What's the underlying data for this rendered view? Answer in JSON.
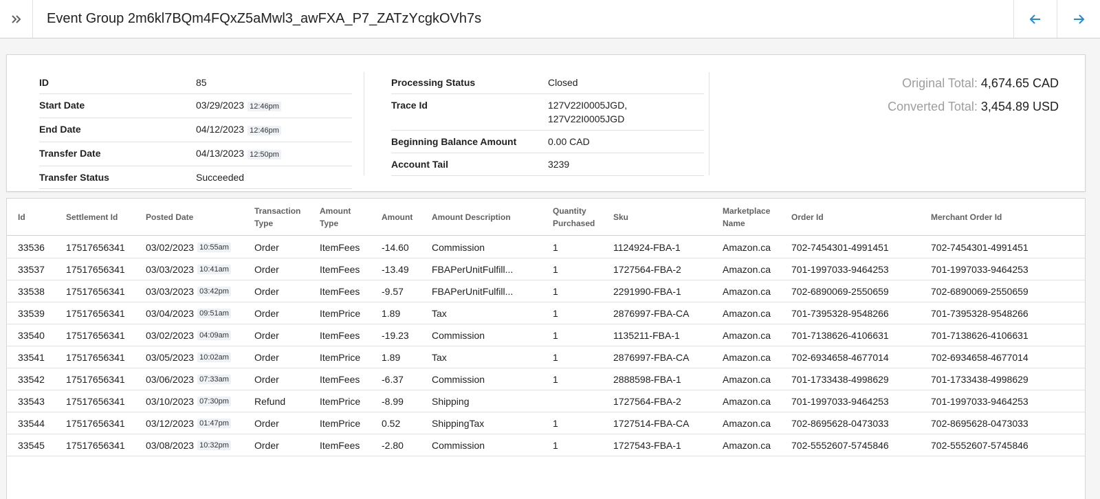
{
  "header": {
    "title": "Event Group 2m6kl7BQm4FQxZ5aMwl3_awFXA_P7_ZATzYcgkOVh7s",
    "toggle_icon": "double-chevron-right-icon",
    "prev_icon": "arrow-left-icon",
    "next_icon": "arrow-right-icon",
    "accent_color": "#1e88e5"
  },
  "summary": {
    "left": [
      {
        "key": "ID",
        "value": "85",
        "time": ""
      },
      {
        "key": "Start Date",
        "value": "03/29/2023",
        "time": "12:46pm"
      },
      {
        "key": "End Date",
        "value": "04/12/2023",
        "time": "12:46pm"
      },
      {
        "key": "Transfer Date",
        "value": "04/13/2023",
        "time": "12:50pm"
      },
      {
        "key": "Transfer Status",
        "value": "Succeeded",
        "time": ""
      }
    ],
    "middle": [
      {
        "key": "Processing Status",
        "value": "Closed"
      },
      {
        "key": "Trace Id",
        "value": "127V22I0005JGD,",
        "value2": "127V22I0005JGD"
      },
      {
        "key": "Beginning Balance Amount",
        "value": "0.00 CAD"
      },
      {
        "key": "Account Tail",
        "value": "3239"
      }
    ],
    "totals": {
      "original_label": "Original Total:",
      "original_value": "4,674.65 CAD",
      "converted_label": "Converted Total:",
      "converted_value": "3,454.89 USD"
    }
  },
  "table": {
    "columns": [
      {
        "line1": "Id",
        "line2": ""
      },
      {
        "line1": "Settlement Id",
        "line2": ""
      },
      {
        "line1": "Posted Date",
        "line2": ""
      },
      {
        "line1": "Transaction",
        "line2": "Type"
      },
      {
        "line1": "Amount",
        "line2": "Type"
      },
      {
        "line1": "Amount",
        "line2": ""
      },
      {
        "line1": "Amount Description",
        "line2": ""
      },
      {
        "line1": "Quantity",
        "line2": "Purchased"
      },
      {
        "line1": "Sku",
        "line2": ""
      },
      {
        "line1": "Marketplace",
        "line2": "Name"
      },
      {
        "line1": "Order Id",
        "line2": ""
      },
      {
        "line1": "Merchant Order Id",
        "line2": ""
      }
    ],
    "rows": [
      {
        "id": "33536",
        "settlement_id": "17517656341",
        "date": "03/02/2023",
        "time": "10:55am",
        "transaction_type": "Order",
        "amount_type": "ItemFees",
        "amount": "-14.60",
        "description": "Commission",
        "quantity": "1",
        "sku": "1124924-FBA-1",
        "marketplace": "Amazon.ca",
        "order_id": "702-7454301-4991451",
        "merchant_order_id": "702-7454301-4991451"
      },
      {
        "id": "33537",
        "settlement_id": "17517656341",
        "date": "03/03/2023",
        "time": "10:41am",
        "transaction_type": "Order",
        "amount_type": "ItemFees",
        "amount": "-13.49",
        "description": "FBAPerUnitFulfill...",
        "quantity": "1",
        "sku": "1727564-FBA-2",
        "marketplace": "Amazon.ca",
        "order_id": "701-1997033-9464253",
        "merchant_order_id": "701-1997033-9464253"
      },
      {
        "id": "33538",
        "settlement_id": "17517656341",
        "date": "03/03/2023",
        "time": "03:42pm",
        "transaction_type": "Order",
        "amount_type": "ItemFees",
        "amount": "-9.57",
        "description": "FBAPerUnitFulfill...",
        "quantity": "1",
        "sku": "2291990-FBA-1",
        "marketplace": "Amazon.ca",
        "order_id": "702-6890069-2550659",
        "merchant_order_id": "702-6890069-2550659"
      },
      {
        "id": "33539",
        "settlement_id": "17517656341",
        "date": "03/04/2023",
        "time": "09:51am",
        "transaction_type": "Order",
        "amount_type": "ItemPrice",
        "amount": "1.89",
        "description": "Tax",
        "quantity": "1",
        "sku": "2876997-FBA-CA",
        "marketplace": "Amazon.ca",
        "order_id": "701-7395328-9548266",
        "merchant_order_id": "701-7395328-9548266"
      },
      {
        "id": "33540",
        "settlement_id": "17517656341",
        "date": "03/02/2023",
        "time": "04:09am",
        "transaction_type": "Order",
        "amount_type": "ItemFees",
        "amount": "-19.23",
        "description": "Commission",
        "quantity": "1",
        "sku": "1135211-FBA-1",
        "marketplace": "Amazon.ca",
        "order_id": "701-7138626-4106631",
        "merchant_order_id": "701-7138626-4106631"
      },
      {
        "id": "33541",
        "settlement_id": "17517656341",
        "date": "03/05/2023",
        "time": "10:02am",
        "transaction_type": "Order",
        "amount_type": "ItemPrice",
        "amount": "1.89",
        "description": "Tax",
        "quantity": "1",
        "sku": "2876997-FBA-CA",
        "marketplace": "Amazon.ca",
        "order_id": "702-6934658-4677014",
        "merchant_order_id": "702-6934658-4677014"
      },
      {
        "id": "33542",
        "settlement_id": "17517656341",
        "date": "03/06/2023",
        "time": "07:33am",
        "transaction_type": "Order",
        "amount_type": "ItemFees",
        "amount": "-6.37",
        "description": "Commission",
        "quantity": "1",
        "sku": "2888598-FBA-1",
        "marketplace": "Amazon.ca",
        "order_id": "701-1733438-4998629",
        "merchant_order_id": "701-1733438-4998629"
      },
      {
        "id": "33543",
        "settlement_id": "17517656341",
        "date": "03/10/2023",
        "time": "07:30pm",
        "transaction_type": "Refund",
        "amount_type": "ItemPrice",
        "amount": "-8.99",
        "description": "Shipping",
        "quantity": "",
        "sku": "1727564-FBA-2",
        "marketplace": "Amazon.ca",
        "order_id": "701-1997033-9464253",
        "merchant_order_id": "701-1997033-9464253"
      },
      {
        "id": "33544",
        "settlement_id": "17517656341",
        "date": "03/12/2023",
        "time": "01:47pm",
        "transaction_type": "Order",
        "amount_type": "ItemPrice",
        "amount": "0.52",
        "description": "ShippingTax",
        "quantity": "1",
        "sku": "1727514-FBA-CA",
        "marketplace": "Amazon.ca",
        "order_id": "702-8695628-0473033",
        "merchant_order_id": "702-8695628-0473033"
      },
      {
        "id": "33545",
        "settlement_id": "17517656341",
        "date": "03/08/2023",
        "time": "10:32pm",
        "transaction_type": "Order",
        "amount_type": "ItemFees",
        "amount": "-2.80",
        "description": "Commission",
        "quantity": "1",
        "sku": "1727543-FBA-1",
        "marketplace": "Amazon.ca",
        "order_id": "702-5552607-5745846",
        "merchant_order_id": "702-5552607-5745846"
      }
    ]
  }
}
